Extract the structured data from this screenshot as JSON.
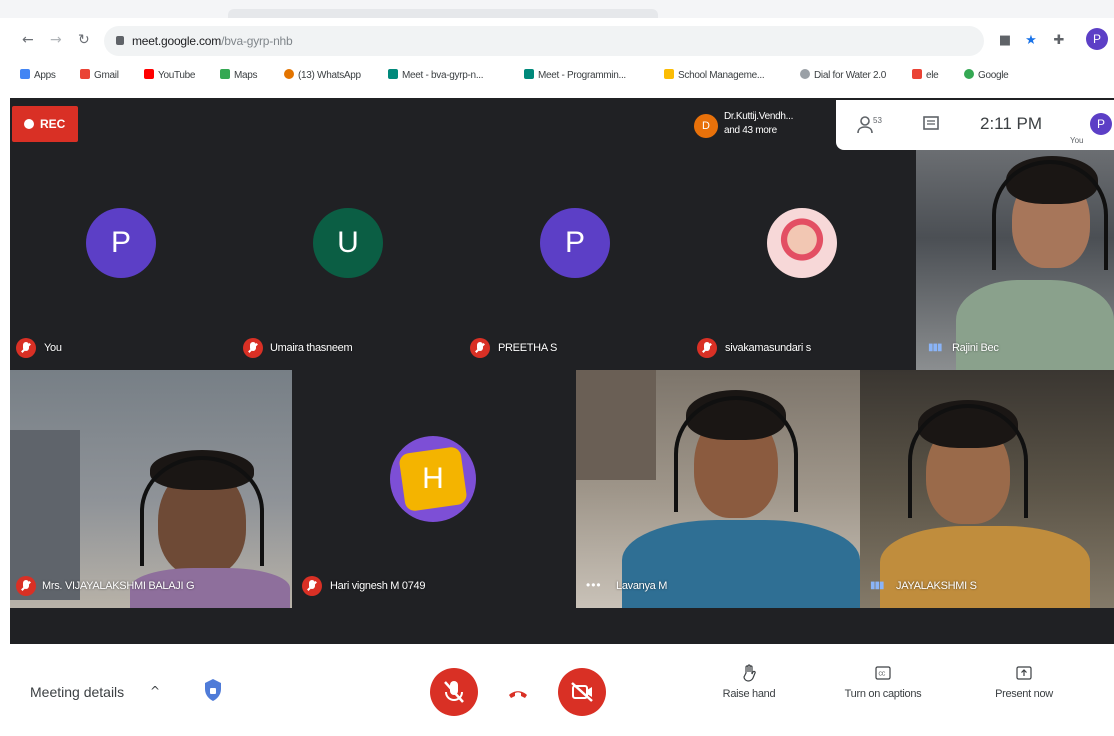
{
  "browser": {
    "url_host": "meet.google.com",
    "url_path": "/bva-gyrp-nhb",
    "profile_initial": "P",
    "bookmarks": [
      {
        "label": "Apps",
        "icon": "apps-grid-icon",
        "color": "#4285f4"
      },
      {
        "label": "Gmail",
        "icon": "gmail-icon",
        "color": "#ea4335"
      },
      {
        "label": "YouTube",
        "icon": "youtube-icon",
        "color": "#ff0000"
      },
      {
        "label": "Maps",
        "icon": "maps-icon",
        "color": "#34a853"
      },
      {
        "label": "(13) WhatsApp",
        "icon": "whatsapp-icon",
        "color": "#e37400"
      },
      {
        "label": "Meet - bva-gyrp-n...",
        "icon": "meet-icon",
        "color": "#00897b"
      },
      {
        "label": "Meet - Programmin...",
        "icon": "meet-icon",
        "color": "#00897b"
      },
      {
        "label": "School Manageme...",
        "icon": "school-icon",
        "color": "#fbbc04"
      },
      {
        "label": "Dial for Water 2.0",
        "icon": "water-icon",
        "color": "#9aa0a6"
      },
      {
        "label": "ele",
        "icon": "gmail-icon",
        "color": "#ea4335"
      },
      {
        "label": "Google",
        "icon": "google-icon",
        "color": "#34a853"
      }
    ]
  },
  "meet": {
    "rec_label": "REC",
    "presenter_initial": "D",
    "presenter_text": "Dr.Kuttij.Vendh...",
    "presenter_more": "and 43 more",
    "people_count": "53",
    "time": "2:11 PM",
    "you_label": "You",
    "you_initial": "P",
    "tiles": [
      {
        "name": "You",
        "initial": "P",
        "color": "#5c3fc6",
        "muted": true
      },
      {
        "name": "Umaira thasneem",
        "initial": "U",
        "color": "#0b5e44",
        "muted": true
      },
      {
        "name": "PREETHA S",
        "initial": "P",
        "color": "#5c3fc6",
        "muted": true
      },
      {
        "name": "sivakamasundari s",
        "initial": "",
        "color": "#e8a6a6",
        "muted": true
      },
      {
        "name": "Rajini Bec",
        "speaking": true
      },
      {
        "name": "Mrs. VIJAYALAKSHMI BALAJI G",
        "muted": true
      },
      {
        "name": "Hari vignesh M 0749",
        "initial": "H",
        "color": "#7d4fd6",
        "muted": true
      },
      {
        "name": "Lavanya M",
        "more": true
      },
      {
        "name": "JAYALAKSHMI S",
        "speaking": true
      }
    ]
  },
  "bottombar": {
    "meeting_details": "Meeting details",
    "raise_hand": "Raise hand",
    "captions": "Turn on captions",
    "present": "Present now"
  },
  "colors": {
    "stage": "#202124",
    "control_red": "#d93025",
    "accent_purple": "#5c3fc6"
  }
}
